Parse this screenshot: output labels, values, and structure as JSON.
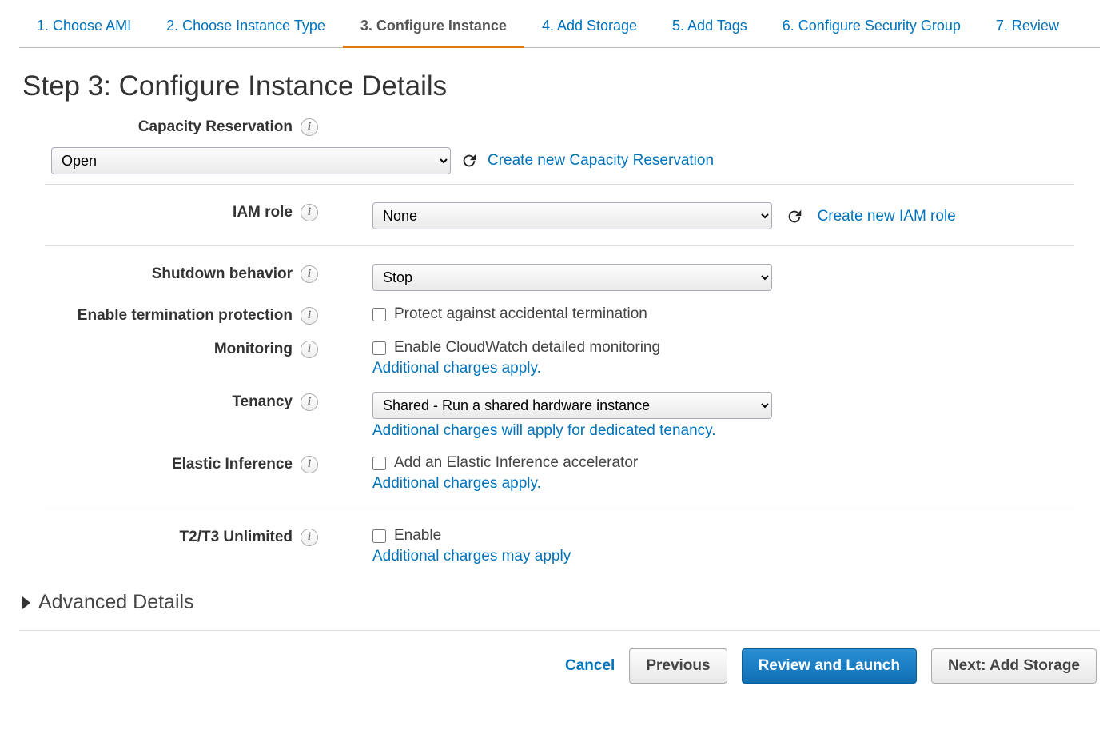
{
  "nav": {
    "steps": [
      "1. Choose AMI",
      "2. Choose Instance Type",
      "3. Configure Instance",
      "4. Add Storage",
      "5. Add Tags",
      "6. Configure Security Group",
      "7. Review"
    ],
    "active_index": 2
  },
  "page_title": "Step 3: Configure Instance Details",
  "form": {
    "capacity_reservation": {
      "label": "Capacity Reservation",
      "value": "Open",
      "create_link": "Create new Capacity Reservation"
    },
    "iam_role": {
      "label": "IAM role",
      "value": "None",
      "create_link": "Create new IAM role"
    },
    "shutdown_behavior": {
      "label": "Shutdown behavior",
      "value": "Stop"
    },
    "termination_protection": {
      "label": "Enable termination protection",
      "checkbox_label": "Protect against accidental termination",
      "checked": false
    },
    "monitoring": {
      "label": "Monitoring",
      "checkbox_label": "Enable CloudWatch detailed monitoring",
      "checked": false,
      "note": "Additional charges apply."
    },
    "tenancy": {
      "label": "Tenancy",
      "value": "Shared - Run a shared hardware instance",
      "note": "Additional charges will apply for dedicated tenancy."
    },
    "elastic_inference": {
      "label": "Elastic Inference",
      "checkbox_label": "Add an Elastic Inference accelerator",
      "checked": false,
      "note": "Additional charges apply."
    },
    "t2t3_unlimited": {
      "label": "T2/T3 Unlimited",
      "checkbox_label": "Enable",
      "checked": false,
      "note": "Additional charges may apply"
    }
  },
  "advanced_label": "Advanced Details",
  "footer": {
    "cancel": "Cancel",
    "previous": "Previous",
    "review_launch": "Review and Launch",
    "next": "Next: Add Storage"
  }
}
